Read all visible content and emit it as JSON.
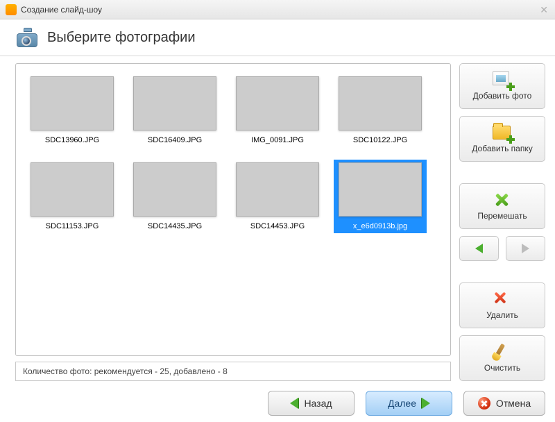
{
  "window": {
    "title": "Создание слайд-шоу"
  },
  "header": {
    "heading": "Выберите фотографии"
  },
  "photos": [
    {
      "filename": "SDC13960.JPG",
      "selected": false,
      "fill": "f1"
    },
    {
      "filename": "SDC16409.JPG",
      "selected": false,
      "fill": "f2"
    },
    {
      "filename": "IMG_0091.JPG",
      "selected": false,
      "fill": "f3"
    },
    {
      "filename": "SDC10122.JPG",
      "selected": false,
      "fill": "f4"
    },
    {
      "filename": "SDC11153.JPG",
      "selected": false,
      "fill": "f5"
    },
    {
      "filename": "SDC14435.JPG",
      "selected": false,
      "fill": "f6"
    },
    {
      "filename": "SDC14453.JPG",
      "selected": false,
      "fill": "f7"
    },
    {
      "filename": "x_e6d0913b.jpg",
      "selected": true,
      "fill": "f8"
    }
  ],
  "status": {
    "text": "Количество фото: рекомендуется - 25, добавлено - 8"
  },
  "sidebar": {
    "add_photo": "Добавить фото",
    "add_folder": "Добавить папку",
    "shuffle": "Перемешать",
    "delete": "Удалить",
    "clear": "Очистить"
  },
  "nav": {
    "back": "Назад",
    "next": "Далее",
    "cancel": "Отмена"
  }
}
